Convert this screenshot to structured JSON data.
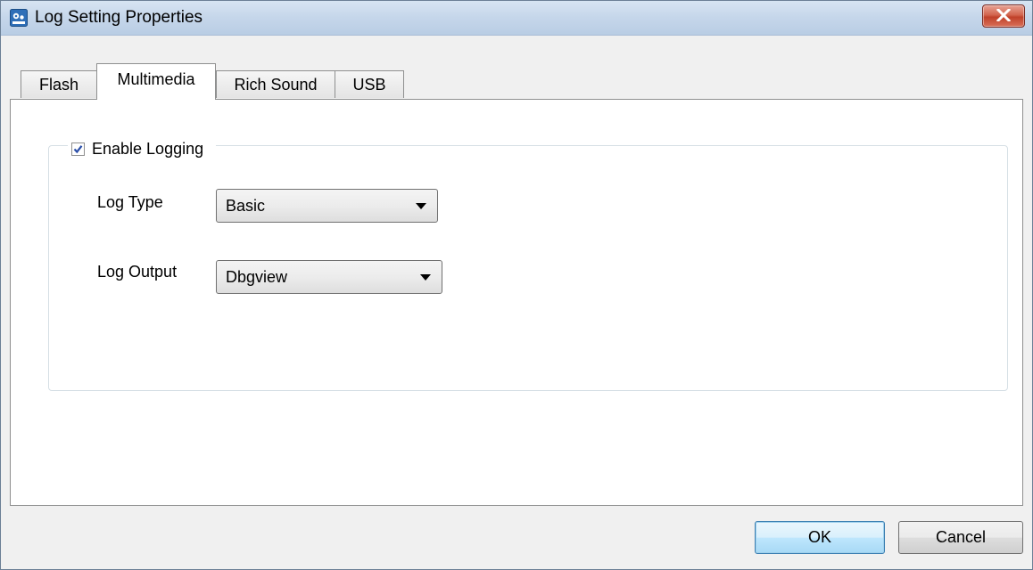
{
  "window": {
    "title": "Log Setting Properties"
  },
  "tabs": [
    {
      "label": "Flash",
      "active": false
    },
    {
      "label": "Multimedia",
      "active": true
    },
    {
      "label": "Rich Sound",
      "active": false
    },
    {
      "label": "USB",
      "active": false
    }
  ],
  "logging": {
    "enable_label": "Enable Logging",
    "enabled": true,
    "log_type_label": "Log Type",
    "log_type_value": "Basic",
    "log_output_label": "Log Output",
    "log_output_value": "Dbgview"
  },
  "buttons": {
    "ok": "OK",
    "cancel": "Cancel"
  },
  "colors": {
    "title_gradient": "#c5d6ea",
    "close_red": "#c0412a",
    "default_button": "#bee6fd"
  },
  "icons": {
    "app": "log-settings-icon",
    "close": "close-icon",
    "dropdown": "dropdown-arrow-icon",
    "check": "checkmark-icon"
  }
}
